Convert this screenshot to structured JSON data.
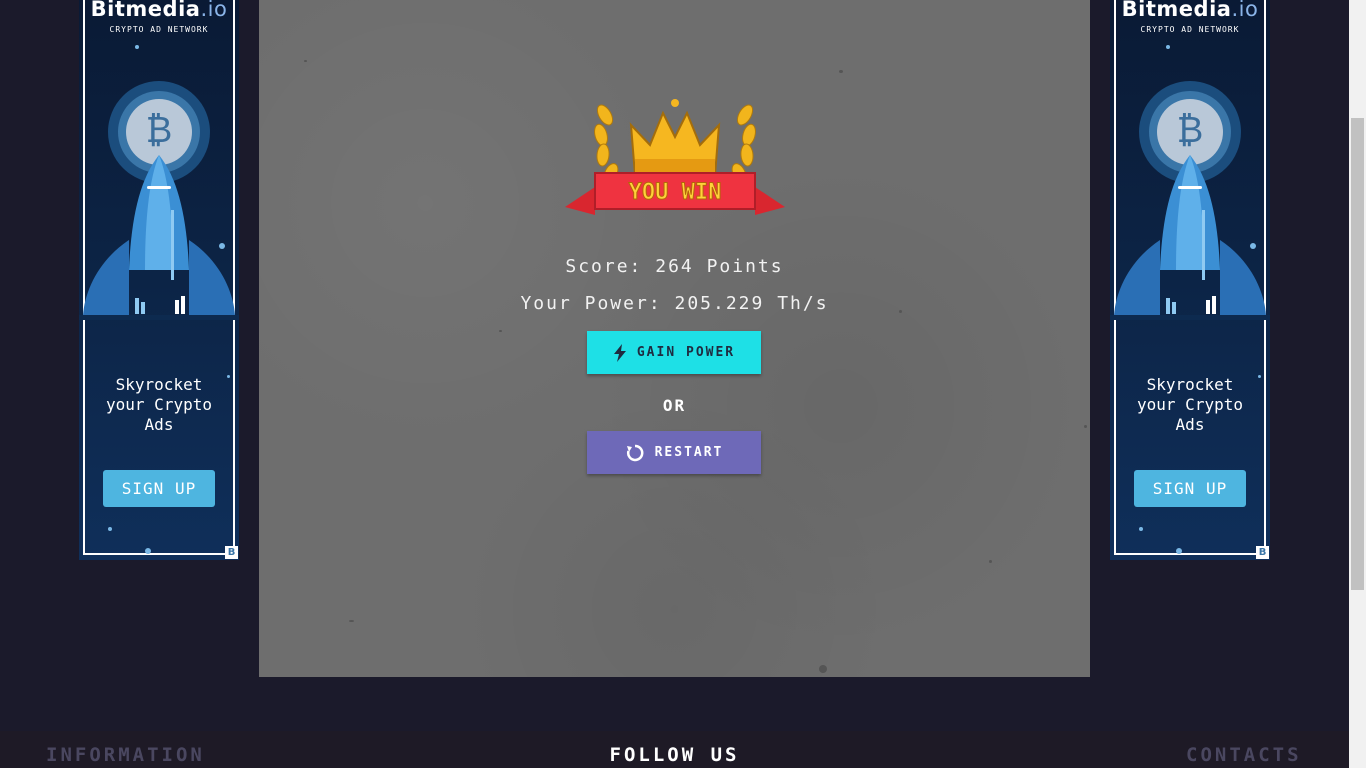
{
  "ads": {
    "brand_main": "Bitmedia",
    "brand_suffix": ".io",
    "tagline": "CRYPTO AD NETWORK",
    "coin_symbol": "₿",
    "copy_line1": "Skyrocket",
    "copy_line2": "your Crypto",
    "copy_line3": "Ads",
    "signup_label": "SIGN UP",
    "adchoice_label": "B"
  },
  "game": {
    "badge_text": "YOU WIN",
    "score_text": "Score: 264 Points",
    "power_text": "Your Power: 205.229 Th/s",
    "gain_power_label": "GAIN POWER",
    "or_label": "OR",
    "restart_label": "RESTART"
  },
  "footer": {
    "information": "INFORMATION",
    "follow_us": "FOLLOW US",
    "contacts": "CONTACTS"
  },
  "colors": {
    "background": "#1b1a2b",
    "gain_button": "#1ee0e6",
    "restart_button": "#6e69b8",
    "ad_button": "#4eb5e0"
  }
}
